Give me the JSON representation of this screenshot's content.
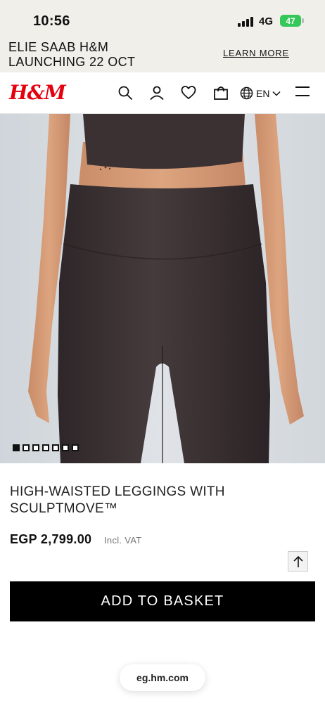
{
  "status_bar": {
    "time": "10:56",
    "network": "4G",
    "battery": "47"
  },
  "promo": {
    "line1": "ELIE SAAB H&M",
    "line2": "LAUNCHING 22 OCT",
    "link": "LEARN MORE"
  },
  "header": {
    "logo": "H&M",
    "icons": [
      "search-icon",
      "account-icon",
      "heart-icon",
      "bag-icon",
      "globe-icon",
      "menu-icon"
    ],
    "language": "EN"
  },
  "gallery": {
    "image_count": 7,
    "active_index": 0
  },
  "product": {
    "title": "HIGH-WAISTED LEGGINGS WITH SCULPTMOVE™",
    "price": "EGP 2,799.00",
    "vat": "Incl. VAT",
    "add_to_basket": "ADD TO BASKET"
  },
  "browser": {
    "url": "eg.hm.com"
  },
  "colors": {
    "accent": "#e50010",
    "banner_bg": "#f0efea",
    "button_bg": "#000000",
    "leggings": "#3b3234"
  }
}
